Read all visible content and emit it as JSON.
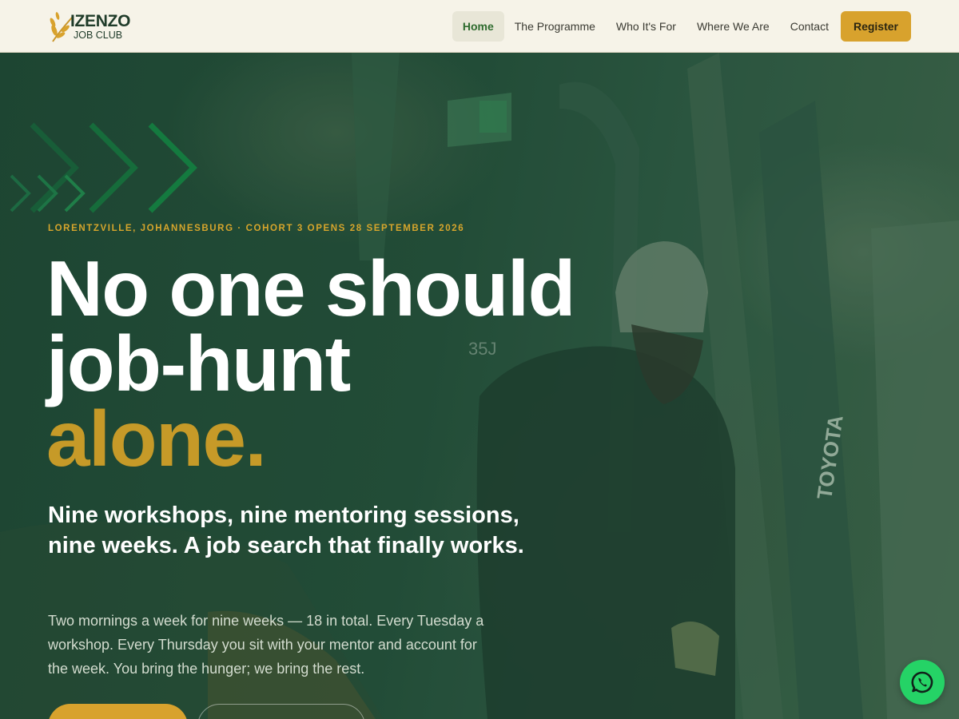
{
  "brand": {
    "name_line1": "IZENZO",
    "name_line2": "JOB CLUB",
    "logo_icon": "wheat-icon"
  },
  "nav": {
    "items": [
      {
        "label": "Home",
        "active": true
      },
      {
        "label": "The Programme",
        "active": false
      },
      {
        "label": "Who It's For",
        "active": false
      },
      {
        "label": "Where We Are",
        "active": false
      },
      {
        "label": "Contact",
        "active": false
      }
    ],
    "register_label": "Register"
  },
  "hero": {
    "eyebrow": "LORENTZVILLE, JOHANNESBURG · COHORT 3 OPENS 28 SEPTEMBER 2026",
    "headline_line1": "No one should",
    "headline_line2": "job-hunt",
    "headline_accent": "alone.",
    "subheading": "Nine workshops, nine mentoring sessions, nine weeks. A job search that finally works.",
    "body": "Two mornings a week for nine weeks — 18 in total. Every Tuesday a workshop. Every Thursday you sit with your mentor and account for the week. You bring the hunger; we bring the rest.",
    "primary_cta": "",
    "secondary_cta": "",
    "decoration_icon": "chevrons-icon",
    "photo_text": {
      "vehicle_brand": "TOYOTA",
      "model_badge": "35J"
    }
  },
  "floating": {
    "whatsapp_icon": "whatsapp-icon"
  },
  "colors": {
    "header_bg": "#f6f3e8",
    "accent_gold": "#d8a22d",
    "hero_green": "#1f4a35",
    "active_nav_text": "#2e6b2e",
    "whatsapp_green": "#25d366"
  }
}
